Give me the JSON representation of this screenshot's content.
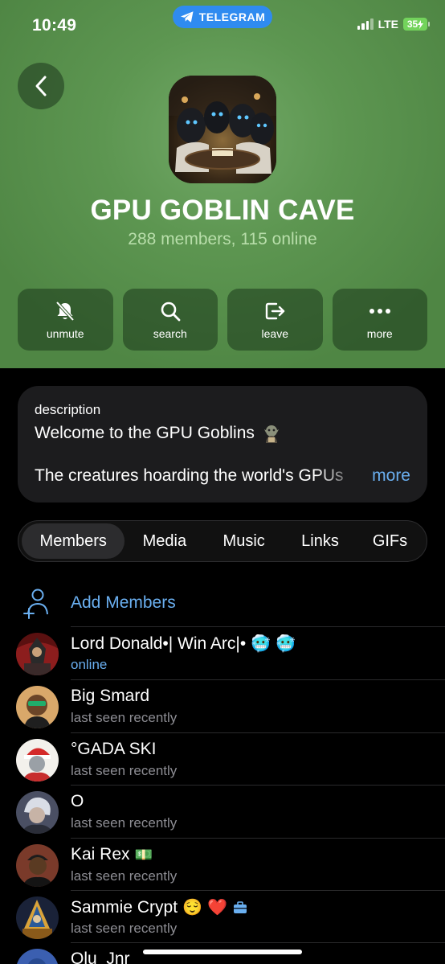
{
  "status_bar": {
    "time": "10:49",
    "pill_label": "TELEGRAM",
    "network": "LTE",
    "battery": "35"
  },
  "header": {
    "back_icon": "chevron-left-icon",
    "title": "GPU GOBLIN CAVE",
    "subtitle": "288 members, 115 online",
    "bg_color": "#5d9651"
  },
  "actions": [
    {
      "label": "unmute",
      "icon": "bell-slash-icon"
    },
    {
      "label": "search",
      "icon": "search-icon"
    },
    {
      "label": "leave",
      "icon": "leave-icon"
    },
    {
      "label": "more",
      "icon": "more-dots-icon"
    }
  ],
  "description": {
    "heading": "description",
    "line1": "Welcome to the GPU Goblins",
    "line1_emoji": "goblin",
    "line2": "The creatures hoarding the world's GPUs",
    "more_label": "more"
  },
  "tabs": [
    "Members",
    "Media",
    "Music",
    "Links",
    "GIFs"
  ],
  "active_tab": "Members",
  "add_members_label": "Add Members",
  "members": [
    {
      "name": "Lord Donald•| Win Arc|•",
      "emojis": [
        "🥶",
        "🥶"
      ],
      "status": "online",
      "online": true
    },
    {
      "name": "Big Smard",
      "emojis": [],
      "status": "last seen recently",
      "online": false
    },
    {
      "name": "°GADA SKI",
      "emojis": [],
      "status": "last seen recently",
      "online": false
    },
    {
      "name": "O",
      "emojis": [],
      "status": "last seen recently",
      "online": false
    },
    {
      "name": "Kai Rex",
      "emojis": [
        "💵"
      ],
      "status": "last seen recently",
      "online": false
    },
    {
      "name": "Sammie Crypt",
      "emojis": [
        "😌",
        "❤️",
        "💼"
      ],
      "status": "last seen recently",
      "online": false
    },
    {
      "name": "Olu_Jnr",
      "emojis": [],
      "status": "",
      "online": false
    }
  ],
  "colors": {
    "accent_blue": "#6aaff0",
    "card_bg": "#1c1c1e",
    "header_green": "#5d9651",
    "pill_blue": "#2f8bf0"
  }
}
